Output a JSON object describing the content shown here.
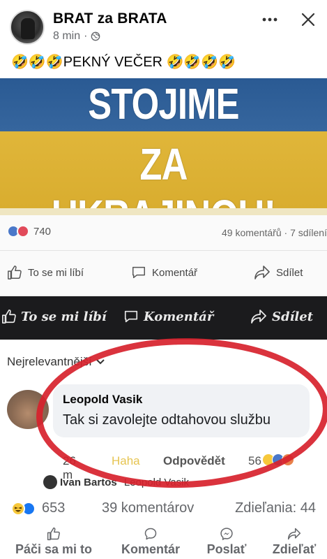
{
  "post": {
    "page_name": "BRAT za BRATA",
    "time": "8 min",
    "separator": "·",
    "text": "🤣🤣🤣PEKNÝ VEČER 🤣🤣🤣🤣"
  },
  "image": {
    "banner_line1": "STOJIME",
    "banner_line2": "ZA UKRAJINOU!",
    "inner_reaction_count": "740",
    "inner_counts": "49 komentářů · 7 sdílení",
    "inner_actions": [
      "To se mi líbí",
      "Komentář",
      "Sdílet"
    ],
    "dark_actions": [
      "To se mi líbí",
      "Komentář",
      "Sdílet"
    ],
    "sort_label": "Nejrelevantnější",
    "comment": {
      "author": "Leopold Vasik",
      "text": "Tak si zavolejte odtahovou službu",
      "time": "26 m",
      "haha": "Haha",
      "reply": "Odpovědět",
      "reaction_count": "56"
    },
    "next_reply": {
      "author": "Ivan Bartos",
      "text": "Leopold Vasik"
    }
  },
  "stats": {
    "reaction_count": "653",
    "comments": "39 komentárov",
    "shares": "Zdieľania: 44"
  },
  "actions": {
    "like": "Páči sa mi to",
    "comment": "Komentár",
    "send": "Poslať",
    "share": "Zdieľať"
  },
  "colors": {
    "like_blue": "#1877f2",
    "haha_yellow": "#f7c83b",
    "flag_blue": "#2a5a93",
    "flag_yellow": "#d9ad2f",
    "circle_red": "#d7222c"
  }
}
